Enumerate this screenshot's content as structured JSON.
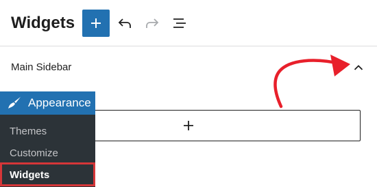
{
  "header": {
    "title": "Widgets",
    "add_icon": "plus-icon",
    "undo_icon": "undo-icon",
    "redo_icon": "redo-icon",
    "list_view_icon": "list-view-icon"
  },
  "widget_area": {
    "title": "Main Sidebar",
    "toggle_icon": "chevron-up-icon",
    "appender_icon": "plus-icon"
  },
  "admin_menu": {
    "section": {
      "label": "Appearance",
      "icon": "paintbrush-icon"
    },
    "items": [
      {
        "label": "Themes"
      },
      {
        "label": "Customize"
      },
      {
        "label": "Widgets",
        "current": true
      }
    ]
  },
  "annotation": {
    "icon": "red-arrow-icon"
  },
  "colors": {
    "accent": "#2271b1",
    "menu_bg": "#2c3338",
    "highlight": "#d63638",
    "menu_text": "#c3c4c7",
    "disabled_icon": "#a7aaad"
  }
}
